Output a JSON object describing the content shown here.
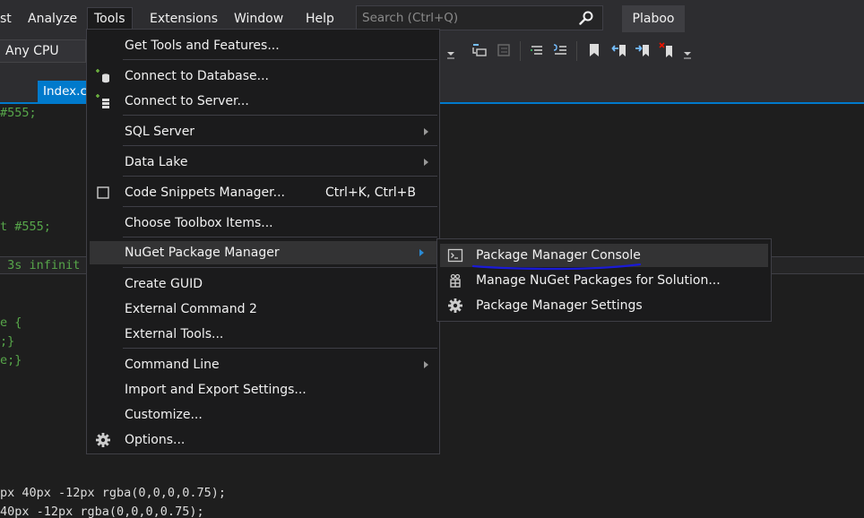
{
  "menubar": {
    "items": [
      "st",
      "Analyze",
      "Tools",
      "Extensions",
      "Window",
      "Help"
    ],
    "active_index": 2,
    "search_placeholder": "Search (Ctrl+Q)",
    "profile": "Plaboo"
  },
  "toolbar": {
    "platform": "Any CPU"
  },
  "editor": {
    "tab_label": "Index.c",
    "lines": [
      "#555;",
      "t #555;",
      " 3s infinit",
      "e {",
      ";}",
      "e;}",
      "px 40px -12px rgba(0,0,0,0.75);",
      "40px -12px rgba(0,0,0,0.75);"
    ]
  },
  "tools_menu": {
    "items": [
      {
        "label": "Get Tools and Features..."
      },
      {
        "label": "Connect to Database...",
        "icon": "database-icon"
      },
      {
        "label": "Connect to Server...",
        "icon": "server-icon"
      },
      {
        "label": "SQL Server",
        "submenu": true
      },
      {
        "label": "Data Lake",
        "submenu": true
      },
      {
        "label": "Code Snippets Manager...",
        "shortcut": "Ctrl+K, Ctrl+B",
        "icon": "snippet-icon"
      },
      {
        "label": "Choose Toolbox Items..."
      },
      {
        "label": "NuGet Package Manager",
        "submenu": true,
        "highlighted": true
      },
      {
        "label": "Create GUID"
      },
      {
        "label": "External Command 2"
      },
      {
        "label": "External Tools..."
      },
      {
        "label": "Command Line",
        "submenu": true
      },
      {
        "label": "Import and Export Settings..."
      },
      {
        "label": "Customize..."
      },
      {
        "label": "Options...",
        "icon": "gear-icon"
      }
    ]
  },
  "nuget_submenu": {
    "items": [
      {
        "label": "Package Manager Console",
        "icon": "console-icon",
        "highlighted": true
      },
      {
        "label": "Manage NuGet Packages for Solution...",
        "icon": "package-icon"
      },
      {
        "label": "Package Manager Settings",
        "icon": "gear-icon"
      }
    ]
  },
  "colors": {
    "accent": "#007acc",
    "menu_bg": "#1b1b1c",
    "hover_bg": "#333334",
    "annotation_underline": "#1a1ad6"
  }
}
